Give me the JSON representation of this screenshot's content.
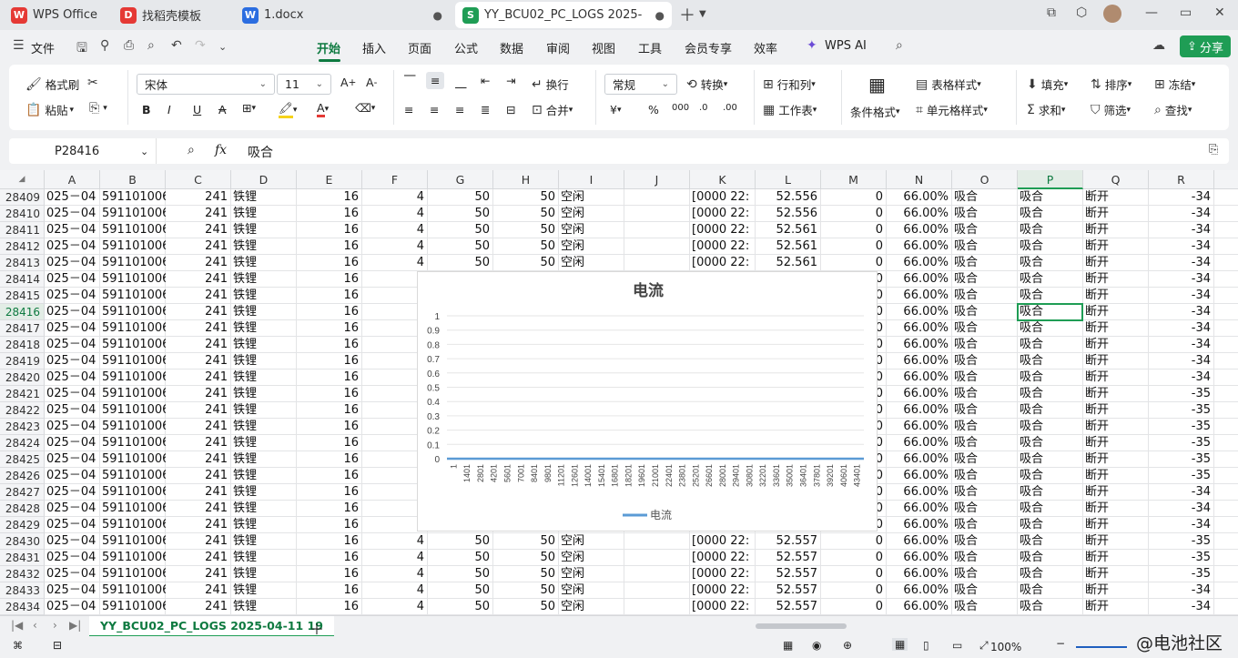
{
  "tabs": [
    {
      "label": "WPS Office",
      "color": "#e53935",
      "glyph": "W"
    },
    {
      "label": "找稻壳模板",
      "color": "#e53935",
      "glyph": "D"
    },
    {
      "label": "1.docx",
      "color": "#2b6de0",
      "glyph": "W"
    },
    {
      "label": "YY_BCU02_PC_LOGS  2025-",
      "color": "#1f9d55",
      "glyph": "S"
    }
  ],
  "menu": {
    "file": "文件",
    "items": [
      "开始",
      "插入",
      "页面",
      "公式",
      "数据",
      "审阅",
      "视图",
      "工具",
      "会员专享",
      "效率"
    ],
    "active": "开始",
    "wps_ai": "WPS AI",
    "share": "分享"
  },
  "ribbon": {
    "format_painter": "格式刷",
    "paste": "粘贴",
    "font_name": "宋体",
    "font_size": "11",
    "wrap": "换行",
    "merge": "合并",
    "number_format": "常规",
    "convert": "转换",
    "rows_cols": "行和列",
    "worksheet": "工作表",
    "cond_format": "条件格式",
    "table_style": "表格样式",
    "cell_style": "单元格样式",
    "fill": "填充",
    "sort": "排序",
    "freeze": "冻结",
    "sum": "求和",
    "filter": "筛选",
    "find": "查找"
  },
  "formula_bar": {
    "name_box": "P28416",
    "fx": "fx",
    "content": "吸合"
  },
  "columns": [
    "A",
    "B",
    "C",
    "D",
    "E",
    "F",
    "G",
    "H",
    "I",
    "J",
    "K",
    "L",
    "M",
    "N",
    "O",
    "P",
    "Q",
    "R"
  ],
  "selected_column": "P",
  "selected_row": "28416",
  "rows": [
    {
      "n": "28409",
      "A": "025－04",
      "B": "591101006",
      "C": "241",
      "D": "铁锂",
      "E": "16",
      "F": "4",
      "G": "50",
      "H": "50",
      "I": "空闲",
      "K": "[0000 22:",
      "L": "52.556",
      "M": "0",
      "N": "66.00%",
      "O": "吸合",
      "P": "吸合",
      "Q": "断开",
      "R": "-34"
    },
    {
      "n": "28410",
      "A": "025－04",
      "B": "591101006",
      "C": "241",
      "D": "铁锂",
      "E": "16",
      "F": "4",
      "G": "50",
      "H": "50",
      "I": "空闲",
      "K": "[0000 22:",
      "L": "52.556",
      "M": "0",
      "N": "66.00%",
      "O": "吸合",
      "P": "吸合",
      "Q": "断开",
      "R": "-34"
    },
    {
      "n": "28411",
      "A": "025－04",
      "B": "591101006",
      "C": "241",
      "D": "铁锂",
      "E": "16",
      "F": "4",
      "G": "50",
      "H": "50",
      "I": "空闲",
      "K": "[0000 22:",
      "L": "52.561",
      "M": "0",
      "N": "66.00%",
      "O": "吸合",
      "P": "吸合",
      "Q": "断开",
      "R": "-34"
    },
    {
      "n": "28412",
      "A": "025－04",
      "B": "591101006",
      "C": "241",
      "D": "铁锂",
      "E": "16",
      "F": "4",
      "G": "50",
      "H": "50",
      "I": "空闲",
      "K": "[0000 22:",
      "L": "52.561",
      "M": "0",
      "N": "66.00%",
      "O": "吸合",
      "P": "吸合",
      "Q": "断开",
      "R": "-34"
    },
    {
      "n": "28413",
      "A": "025－04",
      "B": "591101006",
      "C": "241",
      "D": "铁锂",
      "E": "16",
      "F": "4",
      "G": "50",
      "H": "50",
      "I": "空闲",
      "K": "[0000 22:",
      "L": "52.561",
      "M": "0",
      "N": "66.00%",
      "O": "吸合",
      "P": "吸合",
      "Q": "断开",
      "R": "-34"
    },
    {
      "n": "28414",
      "A": "025－04",
      "B": "591101006",
      "C": "241",
      "D": "铁锂",
      "E": "16",
      "M": "0",
      "N": "66.00%",
      "O": "吸合",
      "P": "吸合",
      "Q": "断开",
      "R": "-34"
    },
    {
      "n": "28415",
      "A": "025－04",
      "B": "591101006",
      "C": "241",
      "D": "铁锂",
      "E": "16",
      "M": "0",
      "N": "66.00%",
      "O": "吸合",
      "P": "吸合",
      "Q": "断开",
      "R": "-34"
    },
    {
      "n": "28416",
      "A": "025－04",
      "B": "591101006",
      "C": "241",
      "D": "铁锂",
      "E": "16",
      "M": "0",
      "N": "66.00%",
      "O": "吸合",
      "P": "吸合",
      "Q": "断开",
      "R": "-34"
    },
    {
      "n": "28417",
      "A": "025－04",
      "B": "591101006",
      "C": "241",
      "D": "铁锂",
      "E": "16",
      "M": "0",
      "N": "66.00%",
      "O": "吸合",
      "P": "吸合",
      "Q": "断开",
      "R": "-34"
    },
    {
      "n": "28418",
      "A": "025－04",
      "B": "591101006",
      "C": "241",
      "D": "铁锂",
      "E": "16",
      "M": "0",
      "N": "66.00%",
      "O": "吸合",
      "P": "吸合",
      "Q": "断开",
      "R": "-34"
    },
    {
      "n": "28419",
      "A": "025－04",
      "B": "591101006",
      "C": "241",
      "D": "铁锂",
      "E": "16",
      "M": "0",
      "N": "66.00%",
      "O": "吸合",
      "P": "吸合",
      "Q": "断开",
      "R": "-34"
    },
    {
      "n": "28420",
      "A": "025－04",
      "B": "591101006",
      "C": "241",
      "D": "铁锂",
      "E": "16",
      "M": "0",
      "N": "66.00%",
      "O": "吸合",
      "P": "吸合",
      "Q": "断开",
      "R": "-34"
    },
    {
      "n": "28421",
      "A": "025－04",
      "B": "591101006",
      "C": "241",
      "D": "铁锂",
      "E": "16",
      "M": "0",
      "N": "66.00%",
      "O": "吸合",
      "P": "吸合",
      "Q": "断开",
      "R": "-35"
    },
    {
      "n": "28422",
      "A": "025－04",
      "B": "591101006",
      "C": "241",
      "D": "铁锂",
      "E": "16",
      "M": "0",
      "N": "66.00%",
      "O": "吸合",
      "P": "吸合",
      "Q": "断开",
      "R": "-35"
    },
    {
      "n": "28423",
      "A": "025－04",
      "B": "591101006",
      "C": "241",
      "D": "铁锂",
      "E": "16",
      "M": "0",
      "N": "66.00%",
      "O": "吸合",
      "P": "吸合",
      "Q": "断开",
      "R": "-35"
    },
    {
      "n": "28424",
      "A": "025－04",
      "B": "591101006",
      "C": "241",
      "D": "铁锂",
      "E": "16",
      "M": "0",
      "N": "66.00%",
      "O": "吸合",
      "P": "吸合",
      "Q": "断开",
      "R": "-35"
    },
    {
      "n": "28425",
      "A": "025－04",
      "B": "591101006",
      "C": "241",
      "D": "铁锂",
      "E": "16",
      "M": "0",
      "N": "66.00%",
      "O": "吸合",
      "P": "吸合",
      "Q": "断开",
      "R": "-35"
    },
    {
      "n": "28426",
      "A": "025－04",
      "B": "591101006",
      "C": "241",
      "D": "铁锂",
      "E": "16",
      "M": "0",
      "N": "66.00%",
      "O": "吸合",
      "P": "吸合",
      "Q": "断开",
      "R": "-35"
    },
    {
      "n": "28427",
      "A": "025－04",
      "B": "591101006",
      "C": "241",
      "D": "铁锂",
      "E": "16",
      "M": "0",
      "N": "66.00%",
      "O": "吸合",
      "P": "吸合",
      "Q": "断开",
      "R": "-34"
    },
    {
      "n": "28428",
      "A": "025－04",
      "B": "591101006",
      "C": "241",
      "D": "铁锂",
      "E": "16",
      "M": "0",
      "N": "66.00%",
      "O": "吸合",
      "P": "吸合",
      "Q": "断开",
      "R": "-34"
    },
    {
      "n": "28429",
      "A": "025－04",
      "B": "591101006",
      "C": "241",
      "D": "铁锂",
      "E": "16",
      "M": "0",
      "N": "66.00%",
      "O": "吸合",
      "P": "吸合",
      "Q": "断开",
      "R": "-34"
    },
    {
      "n": "28430",
      "A": "025－04",
      "B": "591101006",
      "C": "241",
      "D": "铁锂",
      "E": "16",
      "F": "4",
      "G": "50",
      "H": "50",
      "I": "空闲",
      "K": "[0000 22:",
      "L": "52.557",
      "M": "0",
      "N": "66.00%",
      "O": "吸合",
      "P": "吸合",
      "Q": "断开",
      "R": "-35"
    },
    {
      "n": "28431",
      "A": "025－04",
      "B": "591101006",
      "C": "241",
      "D": "铁锂",
      "E": "16",
      "F": "4",
      "G": "50",
      "H": "50",
      "I": "空闲",
      "K": "[0000 22:",
      "L": "52.557",
      "M": "0",
      "N": "66.00%",
      "O": "吸合",
      "P": "吸合",
      "Q": "断开",
      "R": "-35"
    },
    {
      "n": "28432",
      "A": "025－04",
      "B": "591101006",
      "C": "241",
      "D": "铁锂",
      "E": "16",
      "F": "4",
      "G": "50",
      "H": "50",
      "I": "空闲",
      "K": "[0000 22:",
      "L": "52.557",
      "M": "0",
      "N": "66.00%",
      "O": "吸合",
      "P": "吸合",
      "Q": "断开",
      "R": "-35"
    },
    {
      "n": "28433",
      "A": "025－04",
      "B": "591101006",
      "C": "241",
      "D": "铁锂",
      "E": "16",
      "F": "4",
      "G": "50",
      "H": "50",
      "I": "空闲",
      "K": "[0000 22:",
      "L": "52.557",
      "M": "0",
      "N": "66.00%",
      "O": "吸合",
      "P": "吸合",
      "Q": "断开",
      "R": "-34"
    },
    {
      "n": "28434",
      "A": "025－04",
      "B": "591101006",
      "C": "241",
      "D": "铁锂",
      "E": "16",
      "F": "4",
      "G": "50",
      "H": "50",
      "I": "空闲",
      "K": "[0000 22:",
      "L": "52.557",
      "M": "0",
      "N": "66.00%",
      "O": "吸合",
      "P": "吸合",
      "Q": "断开",
      "R": "-34"
    }
  ],
  "chart_data": {
    "type": "line",
    "title": "电流",
    "ylim": [
      0,
      1
    ],
    "yticks": [
      "0",
      "0.1",
      "0.2",
      "0.3",
      "0.4",
      "0.5",
      "0.6",
      "0.7",
      "0.8",
      "0.9",
      "1"
    ],
    "xticks": [
      "1",
      "1401",
      "2801",
      "4201",
      "5601",
      "7001",
      "8401",
      "9801",
      "11201",
      "12601",
      "14001",
      "15401",
      "16801",
      "18201",
      "19601",
      "21001",
      "22401",
      "23801",
      "25201",
      "26601",
      "28001",
      "29401",
      "30801",
      "32201",
      "33601",
      "35001",
      "36401",
      "37801",
      "39201",
      "40601",
      "43401"
    ],
    "series": [
      {
        "name": "电流",
        "color": "#5b9bd5",
        "values": [
          0,
          0,
          0,
          0,
          0,
          0,
          0,
          0,
          0,
          0,
          0,
          0,
          0,
          0,
          0,
          0,
          0,
          0,
          0,
          0,
          0,
          0,
          0,
          0,
          0,
          0,
          0,
          0,
          0,
          0,
          0
        ]
      }
    ],
    "legend": "bottom",
    "grid": true
  },
  "sheet_tab": "YY_BCU02_PC_LOGS  2025-04-11 19",
  "status": {
    "zoom": "100%",
    "watermark": "@电池社区"
  }
}
